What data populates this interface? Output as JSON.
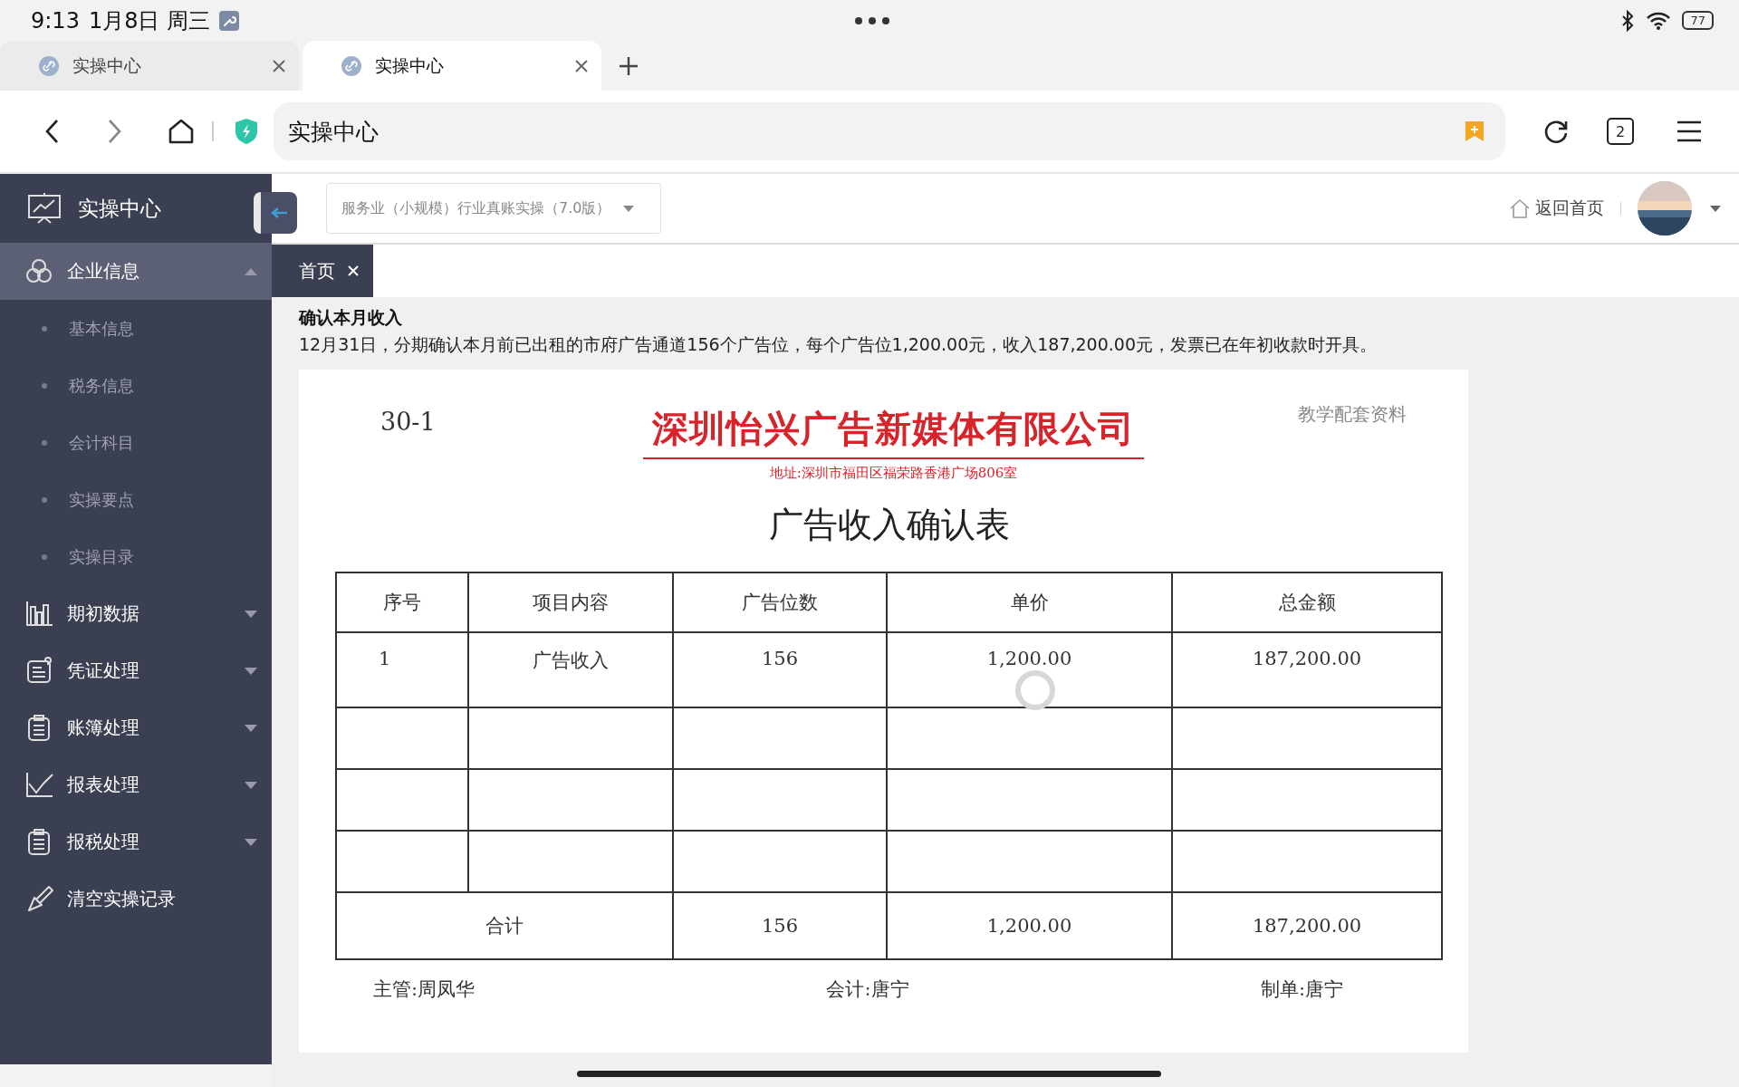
{
  "status_bar": {
    "time": "9:13",
    "date": "1月8日 周三",
    "battery": "77"
  },
  "browser_tabs": [
    {
      "title": "实操中心",
      "selected": false
    },
    {
      "title": "实操中心",
      "selected": true
    }
  ],
  "address_bar": {
    "value": "实操中心",
    "tab_count": "2"
  },
  "sidebar": {
    "title": "实操中心",
    "items": [
      {
        "label": "企业信息",
        "kind": "circles",
        "selected": true,
        "expanded": true,
        "children": [
          {
            "label": "基本信息"
          },
          {
            "label": "税务信息"
          },
          {
            "label": "会计科目"
          },
          {
            "label": "实操要点"
          },
          {
            "label": "实操目录"
          }
        ]
      },
      {
        "label": "期初数据",
        "kind": "bars",
        "selected": false,
        "expanded": false
      },
      {
        "label": "凭证处理",
        "kind": "note",
        "selected": false,
        "expanded": false
      },
      {
        "label": "账簿处理",
        "kind": "clipboard",
        "selected": false,
        "expanded": false
      },
      {
        "label": "报表处理",
        "kind": "line",
        "selected": false,
        "expanded": false
      },
      {
        "label": "报税处理",
        "kind": "clipboard",
        "selected": false,
        "expanded": false
      },
      {
        "label": "清空实操记录",
        "kind": "brush",
        "selected": false
      }
    ]
  },
  "header": {
    "course_select": "服务业（小规模）行业真账实操（7.0版）",
    "home_link": "返回首页"
  },
  "page_tabs": [
    {
      "label": "首页",
      "selected": true
    }
  ],
  "task": {
    "title": "确认本月收入",
    "description": "12月31日，分期确认本月前已出租的市府广告通道156个广告位，每个广告位1,200.00元，收入187,200.00元，发票已在年初收款时开具。"
  },
  "document": {
    "number": "30-1",
    "stamp": "教学配套资料",
    "company": "深圳怡兴广告新媒体有限公司",
    "address": "地址:深圳市福田区福荣路香港广场806室",
    "title": "广告收入确认表",
    "table": {
      "columns": [
        "序号",
        "项目内容",
        "广告位数",
        "单价",
        "总金额"
      ],
      "rows": [
        [
          "1",
          "广告收入",
          "156",
          "1,200.00",
          "187,200.00"
        ],
        [
          "",
          "",
          "",
          "",
          ""
        ],
        [
          "",
          "",
          "",
          "",
          ""
        ],
        [
          "",
          "",
          "",
          "",
          ""
        ]
      ],
      "total": {
        "label": "合计",
        "values": [
          "156",
          "1,200.00",
          "187,200.00"
        ]
      }
    },
    "signatures": [
      "主管:周凤华",
      "会计:唐宁",
      "制单:唐宁"
    ]
  }
}
